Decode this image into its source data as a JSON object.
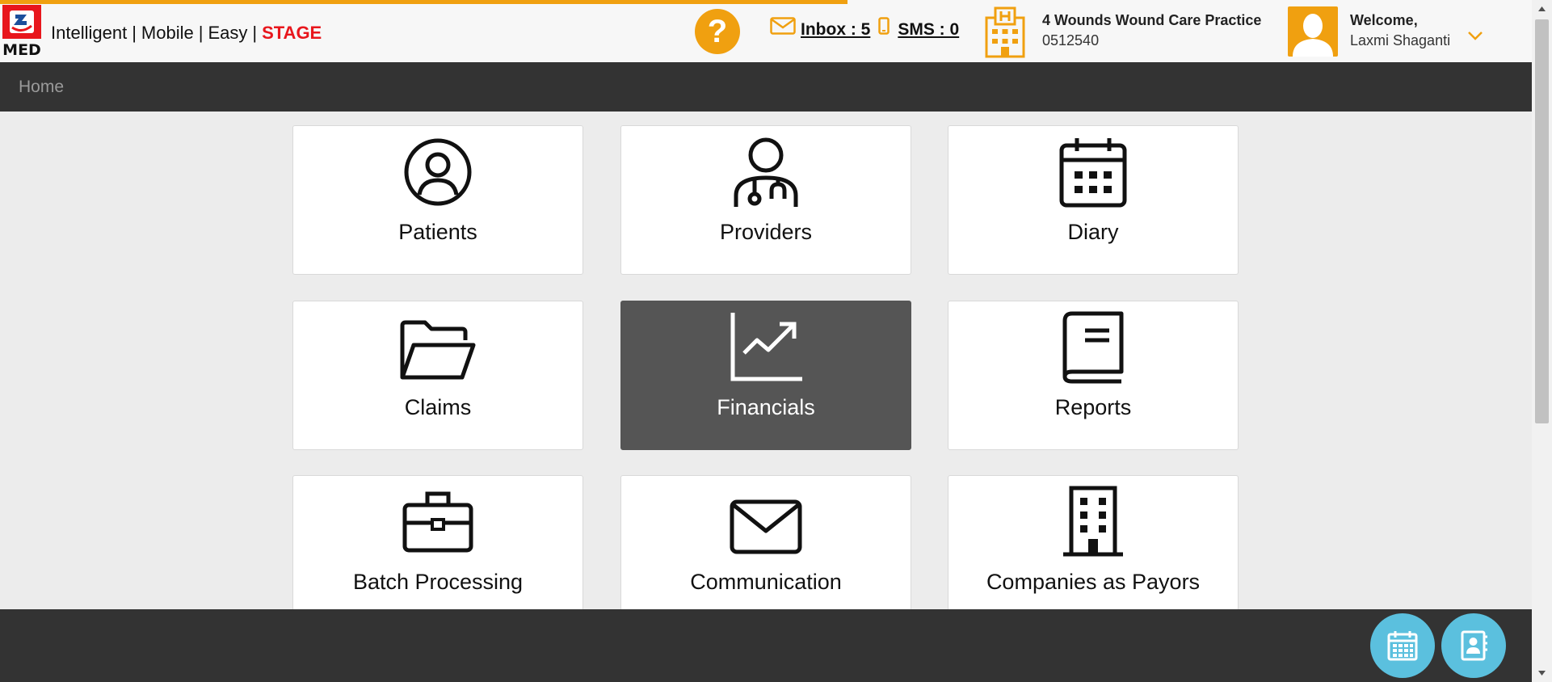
{
  "header": {
    "logo_text": "MED",
    "tagline": {
      "words": [
        "Intelligent",
        "Mobile",
        "Easy"
      ],
      "separator": "|",
      "stage": "STAGE"
    },
    "help_label": "?",
    "inbox_label": "Inbox : 5",
    "sms_label": "SMS : 0",
    "practice": {
      "name": "4 Wounds Wound Care Practice",
      "id": "0512540"
    },
    "welcome_label": "Welcome,",
    "user_name": "Laxmi Shaganti"
  },
  "breadcrumb": {
    "home": "Home"
  },
  "tiles": [
    {
      "label": "Patients",
      "icon": "user-circle-icon"
    },
    {
      "label": "Providers",
      "icon": "doctor-stethoscope-icon"
    },
    {
      "label": "Diary",
      "icon": "calendar-icon"
    },
    {
      "label": "Claims",
      "icon": "folder-open-icon"
    },
    {
      "label": "Financials",
      "icon": "chart-trend-icon"
    },
    {
      "label": "Reports",
      "icon": "book-icon"
    },
    {
      "label": "Batch Processing",
      "icon": "briefcase-icon"
    },
    {
      "label": "Communication",
      "icon": "envelope-icon"
    },
    {
      "label": "Companies as Payors",
      "icon": "building-icon"
    }
  ],
  "active_tile": "Financials",
  "footer": {
    "buttons": [
      "calendar-icon",
      "contacts-icon"
    ]
  },
  "colors": {
    "accent": "#f0a010",
    "stage": "#e8161c",
    "nav": "#333333",
    "active_tile": "#555555",
    "fab": "#5bc0de"
  }
}
